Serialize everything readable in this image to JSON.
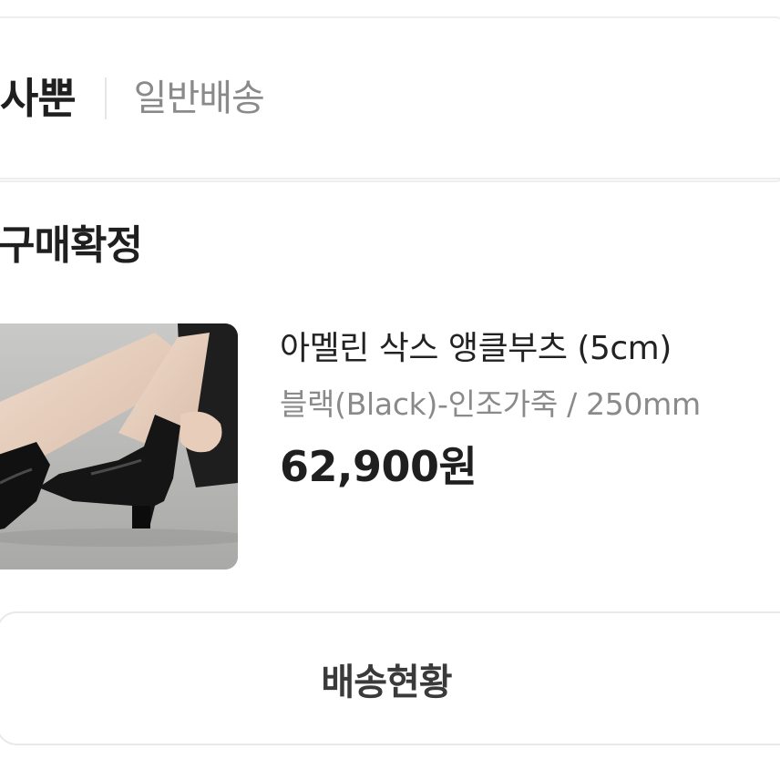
{
  "seller": {
    "name": "사뿐",
    "shipping_type": "일반배송"
  },
  "order": {
    "status": "구매확정",
    "product": {
      "name": "아멜린 삭스 앵클부츠 (5cm)",
      "option": "블랙(Black)-인조가죽 / 250mm",
      "price": "62,900원",
      "image_icon": "ankle-boots-product-photo"
    }
  },
  "actions": {
    "delivery_status_label": "배송현황"
  },
  "colors": {
    "border": "#eeeeee",
    "text_primary": "#1f1f1f",
    "text_secondary": "#8a8a8a"
  }
}
